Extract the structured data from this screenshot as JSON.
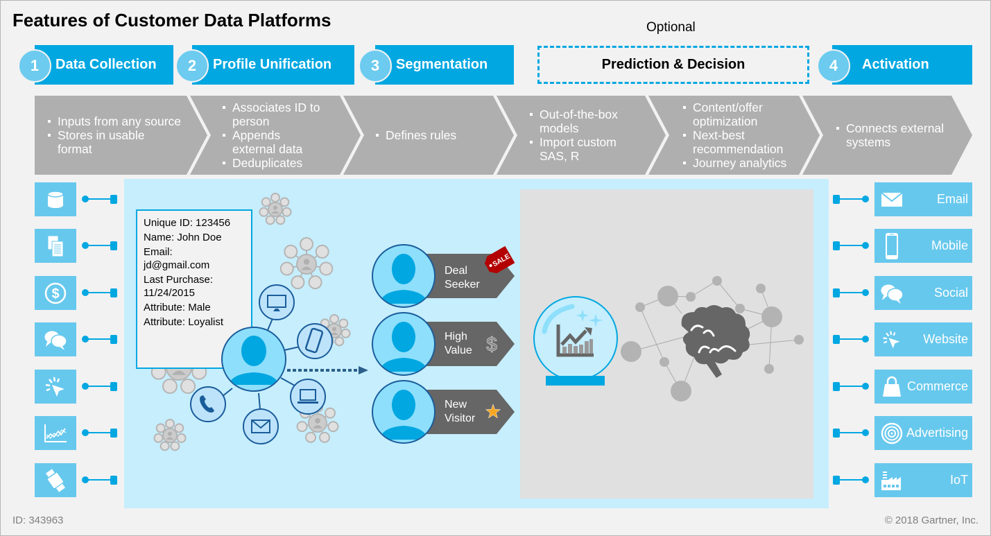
{
  "title": "Features of Customer Data Platforms",
  "optional_label": "Optional",
  "stages": [
    {
      "number": "1",
      "label": "Data Collection"
    },
    {
      "number": "2",
      "label": "Profile Unification"
    },
    {
      "number": "3",
      "label": "Segmentation"
    },
    {
      "number": "",
      "label": "Prediction & Decision",
      "optional": true
    },
    {
      "number": "4",
      "label": "Activation"
    }
  ],
  "features": [
    {
      "bullets": [
        "Inputs from any source",
        "Stores in usable format"
      ]
    },
    {
      "bullets": [
        "Associates ID to person",
        "Appends external data",
        "Deduplicates"
      ]
    },
    {
      "bullets": [
        "Defines rules"
      ]
    },
    {
      "bullets": [
        "Out-of-the-box models",
        "Import custom SAS, R"
      ]
    },
    {
      "bullets": [
        "Content/offer optimization",
        "Next-best recommendation",
        "Journey analytics"
      ]
    },
    {
      "bullets": [
        "Connects external systems"
      ]
    }
  ],
  "sources": [
    {
      "icon": "database-icon"
    },
    {
      "icon": "documents-icon"
    },
    {
      "icon": "dollar-coin-icon"
    },
    {
      "icon": "chat-bubbles-icon"
    },
    {
      "icon": "click-cursor-icon"
    },
    {
      "icon": "line-chart-icon"
    },
    {
      "icon": "smartwatch-icon"
    }
  ],
  "profile": {
    "lines": [
      "Unique ID: 123456",
      "Name: John Doe",
      "Email:",
      "jd@gmail.com",
      "Last Purchase:",
      "11/24/2015",
      "Attribute: Male",
      "Attribute: Loyalist"
    ]
  },
  "segments": [
    {
      "line1": "Deal",
      "line2": "Seeker",
      "badge": "SALE",
      "icon": "sale-tag-icon"
    },
    {
      "line1": "High",
      "line2": "Value",
      "badge": "$",
      "icon": "dollar-icon"
    },
    {
      "line1": "New",
      "line2": "Visitor",
      "badge": "★",
      "icon": "star-icon"
    }
  ],
  "channels": [
    {
      "label": "Email",
      "icon": "envelope-icon"
    },
    {
      "label": "Mobile",
      "icon": "smartphone-icon"
    },
    {
      "label": "Social",
      "icon": "chat-bubbles-icon"
    },
    {
      "label": "Website",
      "icon": "click-cursor-icon"
    },
    {
      "label": "Commerce",
      "icon": "shopping-bag-icon"
    },
    {
      "label": "Advertising",
      "icon": "target-icon"
    },
    {
      "label": "IoT",
      "icon": "factory-icon"
    }
  ],
  "colors": {
    "brand_blue": "#00a7e1",
    "light_blue": "#67c8ed",
    "panel_blue": "#c6eefd",
    "chevron_gray": "#afafaf",
    "dark_gray": "#666666",
    "star_gold": "#f5a623",
    "sale_red": "#b30000"
  },
  "footer": {
    "id": "ID: 343963",
    "copyright": "© 2018 Gartner, Inc."
  }
}
